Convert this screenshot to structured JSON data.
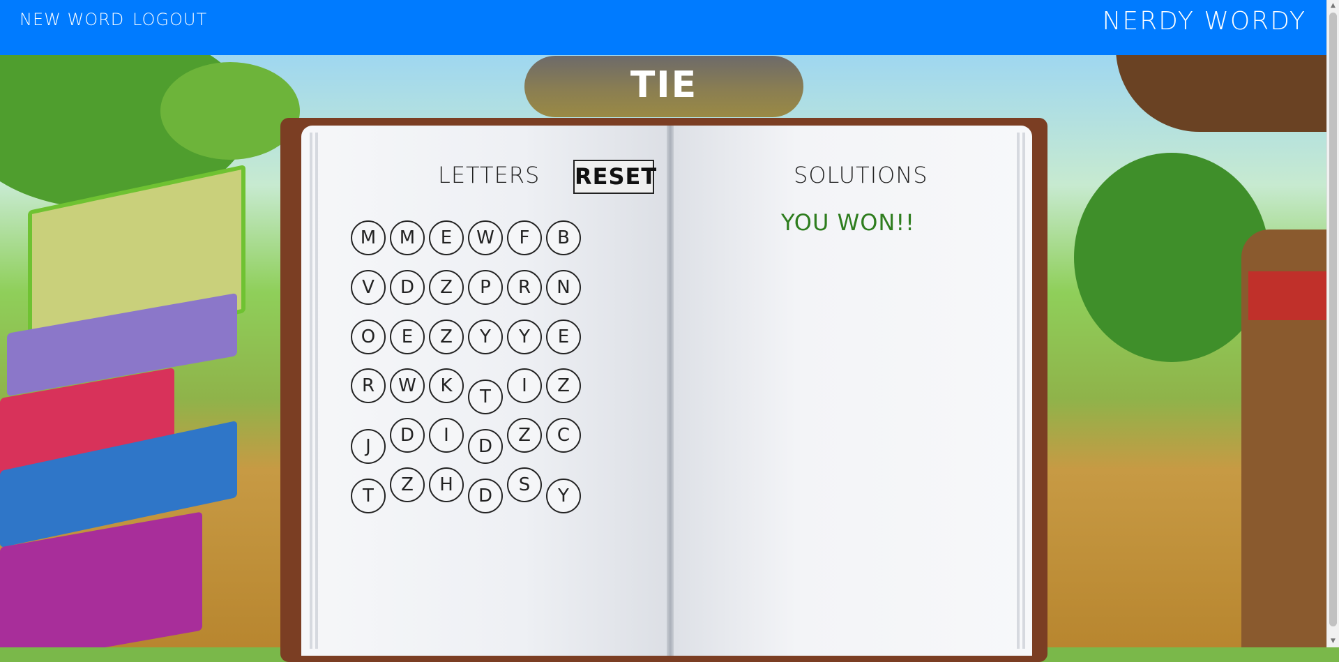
{
  "nav": {
    "new_word": "NEW WORD",
    "logout": "LOGOUT",
    "brand": "NERDY WORDY"
  },
  "status": "TIE",
  "letters_heading": "LETTERS",
  "reset_label": "RESET",
  "solutions_heading": "SOLUTIONS",
  "solutions_message": "YOU WON!!",
  "grid": [
    [
      "M",
      "M",
      "E",
      "W",
      "F",
      "B"
    ],
    [
      "V",
      "D",
      "Z",
      "P",
      "R",
      "N"
    ],
    [
      "O",
      "E",
      "Z",
      "Y",
      "Y",
      "E"
    ],
    [
      "R",
      "W",
      "K",
      "T",
      "I",
      "Z"
    ],
    [
      "J",
      "D",
      "I",
      "D",
      "Z",
      "C"
    ],
    [
      "T",
      "Z",
      "H",
      "D",
      "S",
      "Y"
    ]
  ],
  "colors": {
    "navbar": "#007bff",
    "win_text": "#2e7d1e",
    "book_cover": "#7b3e23"
  }
}
